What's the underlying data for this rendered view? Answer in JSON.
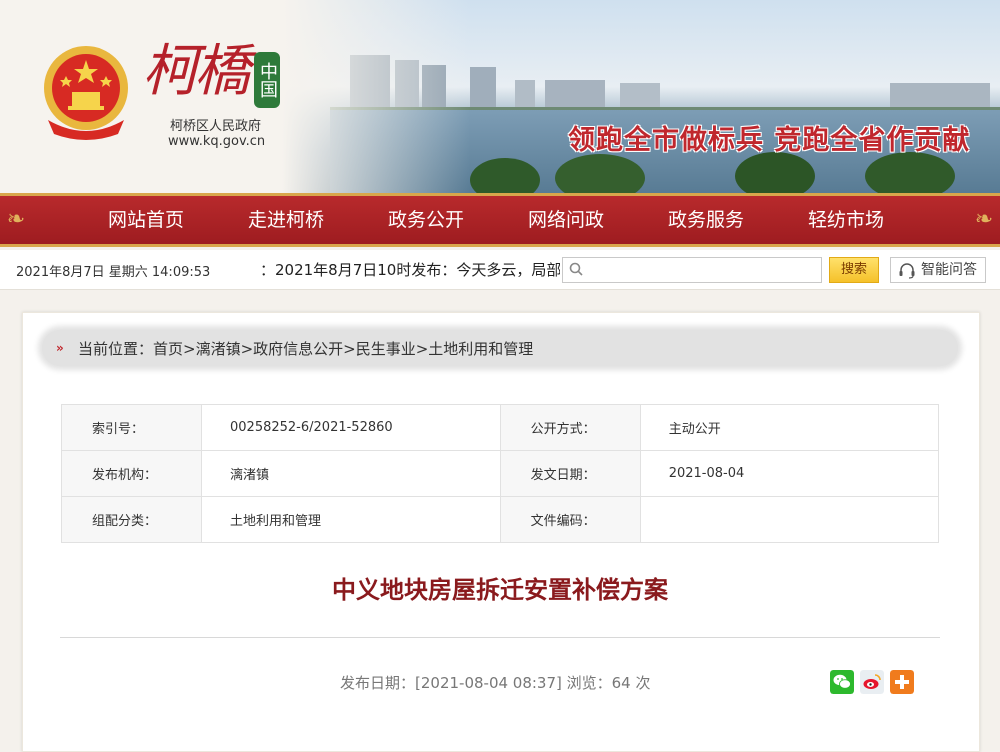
{
  "header": {
    "brand_calligraphy": "柯橋",
    "seal_text": "中国",
    "gov_name": "柯桥区人民政府",
    "gov_url": "www.kq.gov.cn",
    "slogan": "领跑全市做标兵 竞跑全省作贡献"
  },
  "nav": {
    "items": [
      "网站首页",
      "走进柯桥",
      "政务公开",
      "网络问政",
      "政务服务",
      "轻纺市场"
    ]
  },
  "infobar": {
    "datetime": "2021年8月7日 星期六 14:09:53",
    "ticker": "：2021年8月7日10时发布：今天多云，局部",
    "search_placeholder": "",
    "search_button": "搜索",
    "qa_button": "智能问答"
  },
  "breadcrumb": {
    "text": "当前位置：首页>漓渚镇>政府信息公开>民生事业>土地利用和管理"
  },
  "meta": {
    "rows": [
      {
        "k1": "索引号：",
        "v1": "00258252-6/2021-52860",
        "k2": "公开方式：",
        "v2": "主动公开"
      },
      {
        "k1": "发布机构：",
        "v1": "漓渚镇",
        "k2": "发文日期：",
        "v2": "2021-08-04"
      },
      {
        "k1": "组配分类：",
        "v1": "土地利用和管理",
        "k2": "文件编码：",
        "v2": ""
      }
    ]
  },
  "article": {
    "title": "中义地块房屋拆迁安置补偿方案",
    "pubinfo": "发布日期：[2021-08-04 08:37] 浏览：64 次"
  },
  "colors": {
    "nav_red": "#9e1c20",
    "title_red": "#8a1a1d",
    "gold": "#d9a64b",
    "wechat": "#2db92d",
    "weibo": "#e6162d",
    "plus": "#f07b1d"
  },
  "icons": [
    "emblem-icon",
    "search-icon",
    "headset-icon",
    "wechat-icon",
    "weibo-icon",
    "plus-icon",
    "double-arrow-icon"
  ]
}
